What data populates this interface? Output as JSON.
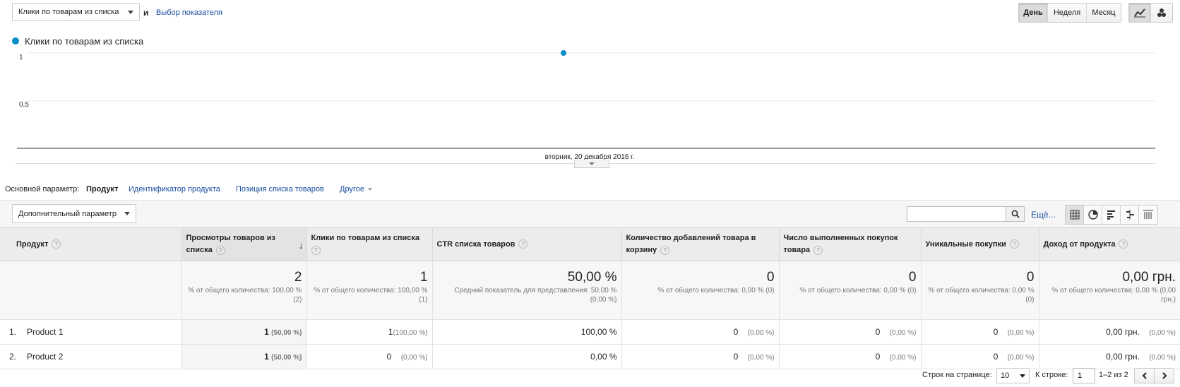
{
  "top": {
    "metric_select": "Клики по товарам из списка",
    "and_label": "и",
    "choose_metric": "Выбор показателя",
    "periods": [
      "День",
      "Неделя",
      "Месяц"
    ],
    "active_period": "День"
  },
  "chart": {
    "legend": "Клики по товарам из списка",
    "color": "#058dc7",
    "y_ticks": [
      "1",
      "0,5"
    ],
    "x_label": "вторник, 20 декабря 2016 г."
  },
  "chart_data": {
    "type": "line",
    "x": [
      "вторник, 20 декабря 2016 г."
    ],
    "series": [
      {
        "name": "Клики по товарам из списка",
        "values": [
          1
        ]
      }
    ],
    "ylim": [
      0,
      1
    ],
    "grid": true,
    "legend_placement": "top-left"
  },
  "dimensions": {
    "label": "Основной параметр:",
    "active": "Продукт",
    "items": [
      "Идентификатор продукта",
      "Позиция списка товаров"
    ],
    "other": "Другое"
  },
  "toolbar": {
    "secondary": "Дополнительный параметр",
    "search_placeholder": "",
    "more": "Ещё..."
  },
  "table": {
    "headers": [
      "Продукт",
      "Просмотры товаров из списка",
      "Клики по товарам из списка",
      "CTR списка товаров",
      "Количество добавлений товара в корзину",
      "Число выполненных покупок товара",
      "Уникальные покупки",
      "Доход от продукта"
    ],
    "totals": [
      {
        "value": "2",
        "sub": "% от общего количества: 100,00 % (2)"
      },
      {
        "value": "1",
        "sub": "% от общего количества: 100,00 % (1)"
      },
      {
        "value": "50,00 %",
        "sub": "Средний показатель для представления: 50,00 % (0,00 %)"
      },
      {
        "value": "0",
        "sub": "% от общего количества: 0,00 % (0)"
      },
      {
        "value": "0",
        "sub": "% от общего количества: 0,00 % (0)"
      },
      {
        "value": "0",
        "sub": "% от общего количества: 0,00 % (0)"
      },
      {
        "value": "0,00 грн.",
        "sub": "% от общего количества: 0,00 % (0,00 грн.)"
      }
    ],
    "rows": [
      {
        "num": "1.",
        "name": "Product 1",
        "views": "1",
        "views_pct": "(50,00 %)",
        "clicks": "1",
        "clicks_pct": "(100,00 %)",
        "ctr": "100,00 %",
        "adds": "0",
        "adds_pct": "(0,00 %)",
        "purchases": "0",
        "purchases_pct": "(0,00 %)",
        "unique": "0",
        "unique_pct": "(0,00 %)",
        "revenue": "0,00 грн.",
        "revenue_pct": "(0,00 %)"
      },
      {
        "num": "2.",
        "name": "Product 2",
        "views": "1",
        "views_pct": "(50,00 %)",
        "clicks": "0",
        "clicks_pct": "(0,00 %)",
        "ctr": "0,00 %",
        "adds": "0",
        "adds_pct": "(0,00 %)",
        "purchases": "0",
        "purchases_pct": "(0,00 %)",
        "unique": "0",
        "unique_pct": "(0,00 %)",
        "revenue": "0,00 грн.",
        "revenue_pct": "(0,00 %)"
      }
    ]
  },
  "pagination": {
    "rows_label": "Строк на странице:",
    "rows_value": "10",
    "goto_label": "К строке:",
    "goto_value": "1",
    "range": "1–2 из 2"
  }
}
